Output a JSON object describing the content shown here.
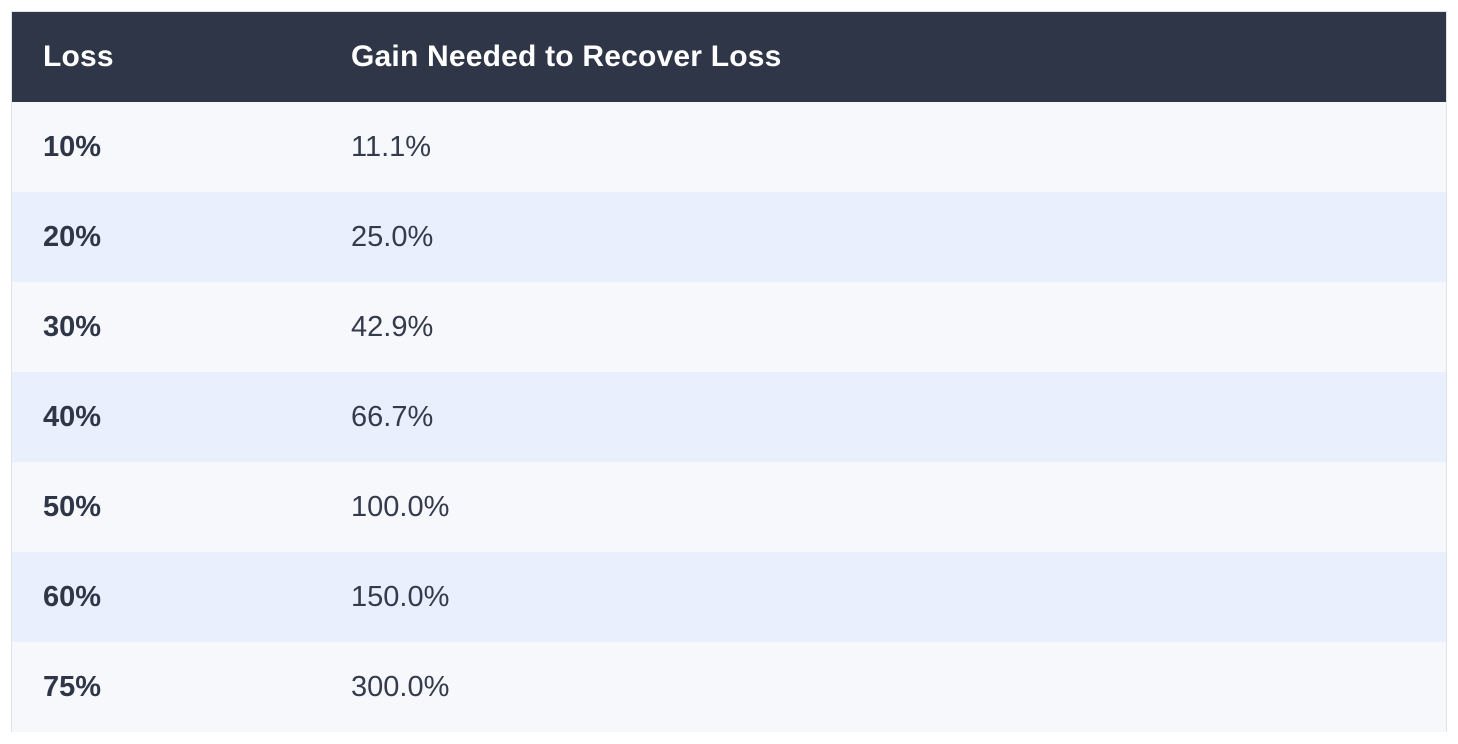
{
  "table": {
    "headers": [
      "Loss",
      "Gain Needed to Recover Loss"
    ],
    "rows": [
      {
        "loss": "10%",
        "gain": "11.1%"
      },
      {
        "loss": "20%",
        "gain": "25.0%"
      },
      {
        "loss": "30%",
        "gain": "42.9%"
      },
      {
        "loss": "40%",
        "gain": "66.7%"
      },
      {
        "loss": "50%",
        "gain": "100.0%"
      },
      {
        "loss": "60%",
        "gain": "150.0%"
      },
      {
        "loss": "75%",
        "gain": "300.0%"
      }
    ]
  },
  "colors": {
    "header_bg": "#2f3647",
    "row_light": "#f6f8fc",
    "row_tinted": "#e9effd",
    "text": "#2f3647"
  }
}
